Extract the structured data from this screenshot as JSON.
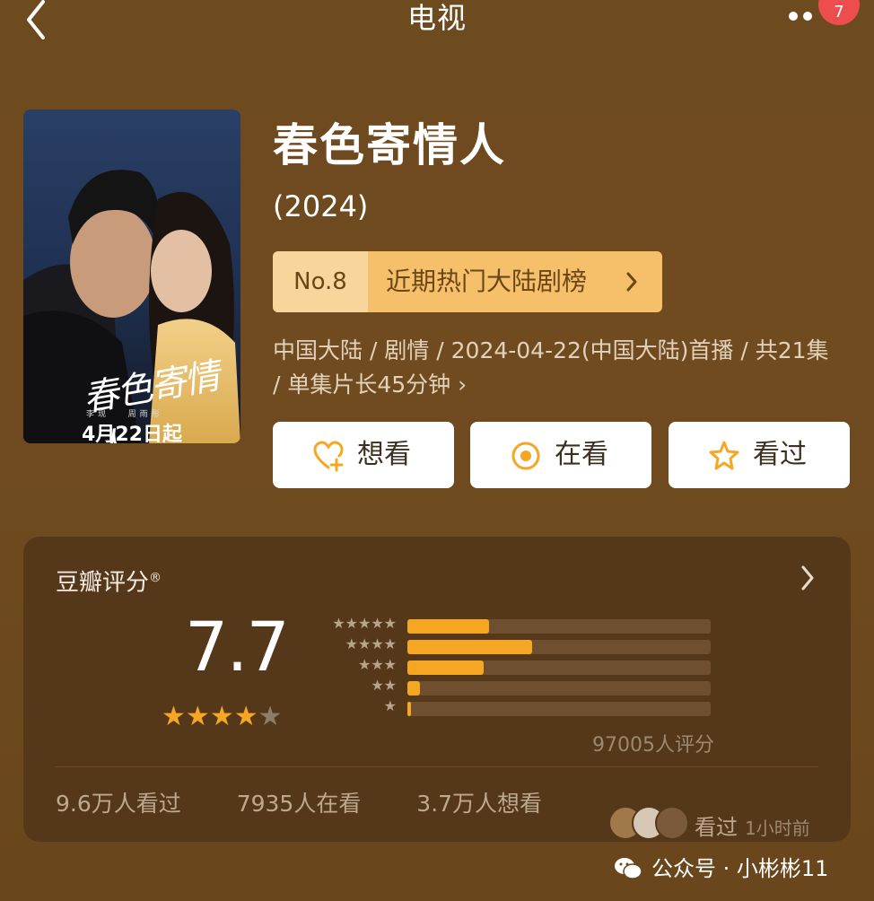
{
  "topbar": {
    "title": "电视",
    "badge": "7"
  },
  "poster": {
    "title_art": "春色寄情人",
    "cast": [
      "李现",
      "周雨彤"
    ],
    "release": "4月22日起"
  },
  "title": "春色寄情人",
  "year": "(2024)",
  "rank": {
    "number": "No.8",
    "label": "近期热门大陆剧榜",
    "arrow": "›"
  },
  "info": {
    "text": "中国大陆 / 剧情 / 2024-04-22(中国大陆)首播 / 共21集 / 单集片长45分钟",
    "arrow": "›"
  },
  "actions": [
    {
      "label": "想看",
      "icon": "heart-plus-icon"
    },
    {
      "label": "在看",
      "icon": "target-icon"
    },
    {
      "label": "看过",
      "icon": "star-outline-icon"
    }
  ],
  "rating": {
    "source": "豆瓣评分",
    "registered": "®",
    "score": "7.7",
    "stars": 4,
    "max_stars": 5,
    "distribution": [
      {
        "stars": "★★★★★",
        "fraction": 0.27
      },
      {
        "stars": "★★★★",
        "fraction": 0.41
      },
      {
        "stars": "★★★",
        "fraction": 0.25
      },
      {
        "stars": "★★",
        "fraction": 0.04
      },
      {
        "stars": "★",
        "fraction": 0.01
      }
    ],
    "count": "97005人评分"
  },
  "stats": {
    "watched": "9.6万人看过",
    "watching": "7935人在看",
    "want": "3.7万人想看"
  },
  "friend": {
    "action": "看过",
    "time": "1小时前"
  },
  "watermark": {
    "text": "公众号 · 小彬彬11"
  },
  "colors": {
    "background": "#6e4a1f",
    "card": "#55381a",
    "accent": "#f5a623",
    "rank_bg": "#f6c06a"
  }
}
